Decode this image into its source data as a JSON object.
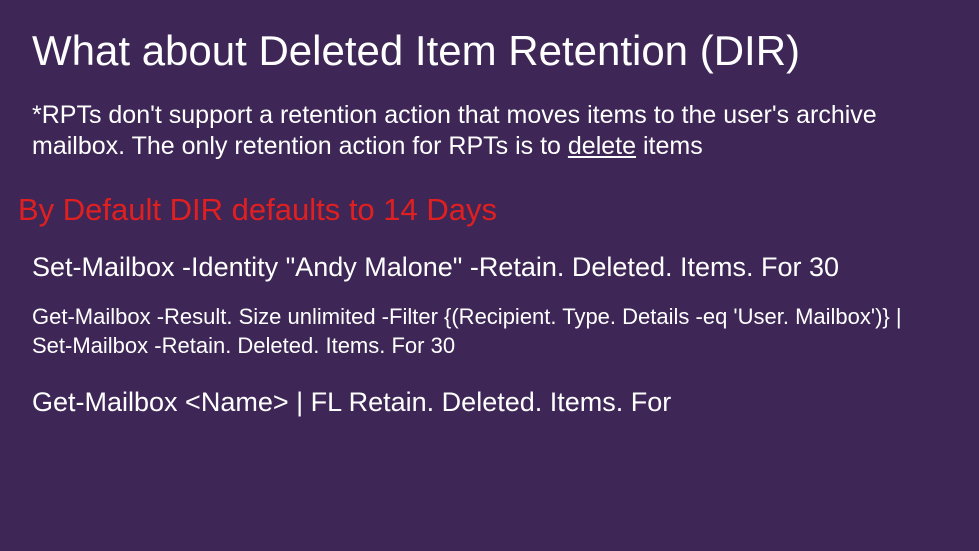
{
  "title": "What about Deleted Item Retention (DIR)",
  "body": {
    "pre": "*RPTs don't support a retention action that moves items to the user's archive mailbox. The only retention action for RPTs is to ",
    "underlined": "delete",
    "post": " items"
  },
  "subtitle": "By Default DIR defaults to 14 Days",
  "cmd1": "Set-Mailbox -Identity \"Andy Malone\" -Retain. Deleted. Items. For 30",
  "cmd2": "Get-Mailbox -Result. Size unlimited -Filter {(Recipient. Type. Details -eq 'User. Mailbox')} | Set-Mailbox -Retain. Deleted. Items. For 30",
  "cmd3": "Get-Mailbox <Name> | FL Retain. Deleted. Items. For"
}
